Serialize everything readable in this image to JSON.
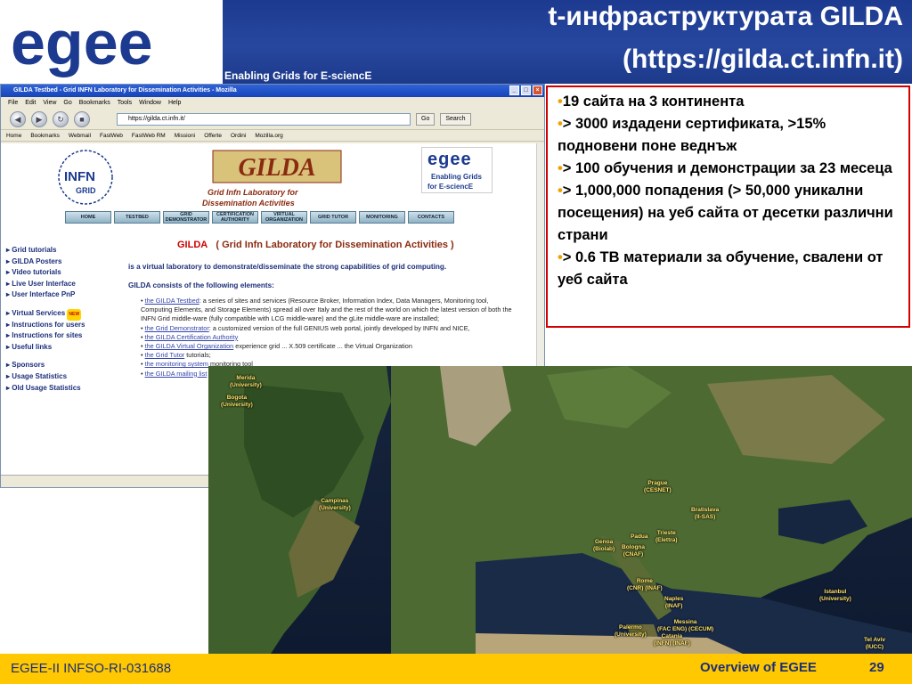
{
  "slide": {
    "title_line1": "t-инфраструктурата GILDA",
    "title_line2": "(https://gilda.ct.infn.it)",
    "tagline": "Enabling Grids for E-sciencE",
    "logo_text": "egee"
  },
  "browser": {
    "window_title": "GILDA Testbed - Grid INFN Laboratory for Dissemination Activities - Mozilla",
    "menu": [
      "File",
      "Edit",
      "View",
      "Go",
      "Bookmarks",
      "Tools",
      "Window",
      "Help"
    ],
    "url": "https://gilda.ct.infn.it/",
    "go_label": "Go",
    "search_label": "Search",
    "bookmarks": [
      "Home",
      "Bookmarks",
      "Webmail",
      "FastWeb",
      "FastWeb RM",
      "Missioni",
      "Offerte",
      "Ordini",
      "Mozilla.org"
    ],
    "page": {
      "infn_label": "INFN",
      "grid_label": "GRID",
      "banner_text": "GILDA",
      "banner_sub1": "Grid Infn Laboratory for",
      "banner_sub2": "Dissemination Activities",
      "egee_word": "egee",
      "egee_tag1": "Enabling Grids",
      "egee_tag2": "for E-sciencE",
      "nav": [
        "HOME",
        "TESTBED",
        "GRID DEMONSTRATOR",
        "CERTIFICATION AUTHORITY",
        "VIRTUAL ORGANIZATION",
        "GRID TUTOR",
        "MONITORING",
        "CONTACTS"
      ],
      "left_links_1": [
        "Grid tutorials",
        "GILDA Posters",
        "Video tutorials",
        "Live User Interface",
        "User Interface PnP"
      ],
      "left_links_2": [
        "Virtual Services",
        "Instructions for users",
        "Instructions for sites",
        "Useful links"
      ],
      "left_links_3": [
        "Sponsors",
        "Usage Statistics",
        "Old Usage Statistics"
      ],
      "new_badge": "NEW",
      "heading_prefix": "GILDA",
      "heading_rest": "( Grid Infn Laboratory for Dissemination Activities )",
      "intro": "is a virtual laboratory to demonstrate/disseminate the strong capabilities of grid computing.",
      "consists": "GILDA consists of the following elements:",
      "bullet1_link": "the GILDA Testbed",
      "bullet1_text": ": a series of sites and services (Resource Broker, Information Index, Data Managers, Monitoring tool, Computing Elements, and Storage Elements) spread all over Italy and the rest of the world on which the latest version of both the INFN Grid middle-ware (fully compatible with LCG middle-ware) and the gLite middle-ware are installed;",
      "bullet2_link": "the Grid Demonstrator",
      "bullet2_text": ": a customized version of the full GENIUS web portal, jointly developed by INFN and NICE,",
      "bullet3_link": "the GILDA Certification Authority",
      "bullet4_link": "the GILDA Virtual Organization",
      "bullet4_text": "experience grid ... X.509 certificate ... the Virtual Organization",
      "bullet5_link": "the Grid Tutor",
      "bullet5_text": "tutorials;",
      "bullet6_link": "the monitoring system",
      "bullet6_text": "monitoring tool",
      "bullet7_link": "the GILDA mailing list"
    }
  },
  "bullets": [
    "19 сайта на 3 континента",
    "> 3000 издадени сертификата,  >15% подновени поне веднъж",
    "> 100 обучения и демонстрации за 23 месеца",
    "> 1,000,000 попадения (> 50,000 уникални посещения) на уеб сайта от десетки различни страни",
    "> 0.6 TB материали за обучение, свалени от уеб сайта"
  ],
  "map_places": [
    {
      "name": "Merida",
      "sub": "(University)"
    },
    {
      "name": "Bogota",
      "sub": "(University)"
    },
    {
      "name": "Campinas",
      "sub": "(University)"
    },
    {
      "name": "Prague",
      "sub": "(CESNET)"
    },
    {
      "name": "Bratislava",
      "sub": "(II-SAS)"
    },
    {
      "name": "Padua",
      "sub": ""
    },
    {
      "name": "Trieste",
      "sub": "(Elettra)"
    },
    {
      "name": "Genoa",
      "sub": "(Biolab)"
    },
    {
      "name": "Bologna",
      "sub": "(CNAF)"
    },
    {
      "name": "Rome",
      "sub": "(CNR) (INAF)"
    },
    {
      "name": "Naples",
      "sub": "(INAF)"
    },
    {
      "name": "Istanbul",
      "sub": "(University)"
    },
    {
      "name": "Palermo",
      "sub": "(University)"
    },
    {
      "name": "Messina",
      "sub": "(FAC ENG) (CECUM)"
    },
    {
      "name": "Catania",
      "sub": "(INFN) (INAF)"
    },
    {
      "name": "Tel Aviv",
      "sub": "(IUCC)"
    }
  ],
  "footer": {
    "left": "EGEE-II INFSO-RI-031688",
    "center": "Overview of EGEE",
    "page": "29"
  },
  "colors": {
    "blue": "#1c3a8f",
    "egee_yellow": "#ffc800",
    "border_red": "#d20000",
    "bullet_orange": "#f0a000"
  }
}
